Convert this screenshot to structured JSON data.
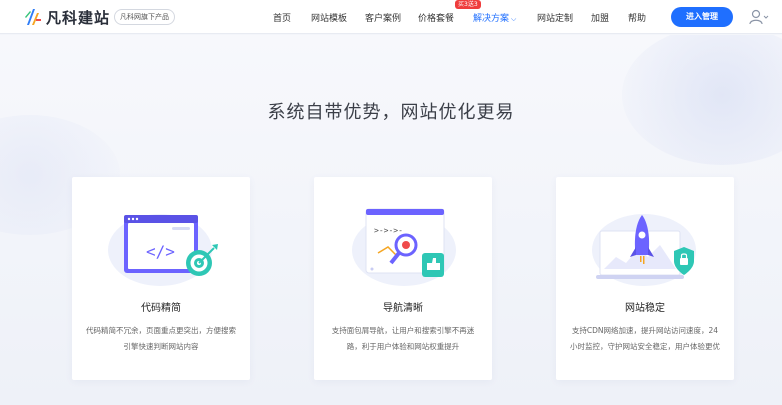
{
  "header": {
    "logo_text": "凡科建站",
    "logo_sub": "凡科网旗下产品",
    "nav": [
      {
        "label": "首页"
      },
      {
        "label": "网站模板"
      },
      {
        "label": "客户案例"
      },
      {
        "label": "价格套餐"
      },
      {
        "label": "解决方案"
      },
      {
        "label": "网站定制"
      },
      {
        "label": "加盟"
      },
      {
        "label": "帮助"
      }
    ],
    "hot_badge": "买3送3",
    "cta": "进入管理"
  },
  "section": {
    "title": "系统自带优势，网站优化更易"
  },
  "cards": [
    {
      "title": "代码精简",
      "desc": "代码精简不冗余，页面重点更突出，方便搜索引擎快速判断网站内容"
    },
    {
      "title": "导航清晰",
      "desc": "支持面包屑导航，让用户和搜索引擎不再迷路，利于用户体验和网站权重提升"
    },
    {
      "title": "网站稳定",
      "desc": "支持CDN网络加速，提升网站访问速度，24小时监控，守护网站安全稳定，用户体验更优"
    }
  ],
  "colors": {
    "accent": "#1f6fff",
    "badge": "#ef3d3d"
  },
  "icons": [
    "logo-icon",
    "chevron-down-icon",
    "user-icon",
    "code-window-icon",
    "navigation-search-icon",
    "rocket-shield-icon"
  ]
}
